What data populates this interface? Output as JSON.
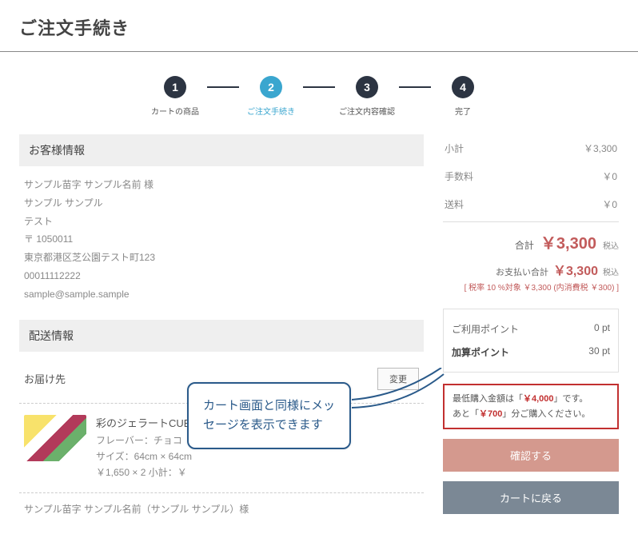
{
  "page_title": "ご注文手続き",
  "steps": [
    {
      "num": "1",
      "label": "カートの商品"
    },
    {
      "num": "2",
      "label": "ご注文手続き"
    },
    {
      "num": "3",
      "label": "ご注文内容確認"
    },
    {
      "num": "4",
      "label": "完了"
    }
  ],
  "customer": {
    "header": "お客様情報",
    "lines": [
      "サンプル苗字 サンプル名前 様",
      "サンプル サンプル",
      "テスト",
      "〒 1050011",
      "東京都港区芝公園テスト町123",
      "00011112222",
      "sample@sample.sample"
    ]
  },
  "shipping": {
    "header": "配送情報",
    "dest_label": "お届け先",
    "change_label": "変更",
    "product": {
      "name": "彩のジェラートCUBE",
      "flavor": "フレーバー：チョコ",
      "size": "サイズ：64cm × 64cm",
      "price_line": "￥1,650 × 2  小計：￥"
    },
    "dest_lines": [
      "サンプル苗字 サンプル名前（サンプル サンプル）様"
    ]
  },
  "summary": {
    "subtotal_label": "小計",
    "subtotal_value": "￥3,300",
    "fee_label": "手数料",
    "fee_value": "￥0",
    "ship_label": "送料",
    "ship_value": "￥0",
    "total_label": "合計",
    "total_value": "￥3,300",
    "tax_incl": "税込",
    "pay_label": "お支払い合計",
    "pay_value": "￥3,300",
    "tax_note": "[ 税率 10 %対象 ￥3,300 (内消費税 ￥300) ]"
  },
  "points": {
    "use_label": "ご利用ポイント",
    "use_value": "0 pt",
    "add_label": "加算ポイント",
    "add_value": "30 pt"
  },
  "warning": {
    "line1_a": "最低購入金額は「",
    "line1_red": "￥4,000",
    "line1_b": "」です。",
    "line2_a": "あと「",
    "line2_red": "￥700",
    "line2_b": "」分ご購入ください。"
  },
  "buttons": {
    "confirm": "確認する",
    "back": "カートに戻る"
  },
  "callout": {
    "line1": "カート画面と同様にメッ",
    "line2": "セージを表示できます"
  }
}
